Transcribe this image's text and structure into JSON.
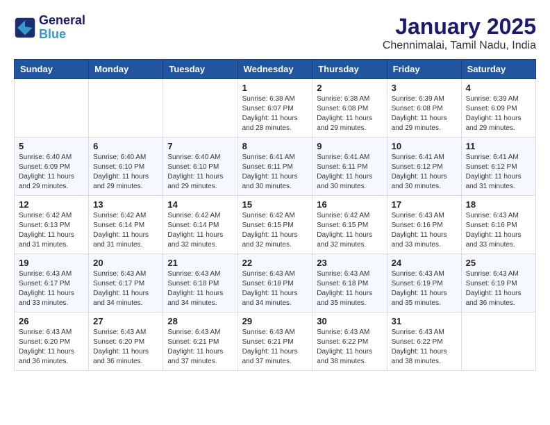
{
  "logo": {
    "line1": "General",
    "line2": "Blue"
  },
  "header": {
    "month": "January 2025",
    "location": "Chennimalai, Tamil Nadu, India"
  },
  "weekdays": [
    "Sunday",
    "Monday",
    "Tuesday",
    "Wednesday",
    "Thursday",
    "Friday",
    "Saturday"
  ],
  "weeks": [
    [
      {
        "day": "",
        "info": ""
      },
      {
        "day": "",
        "info": ""
      },
      {
        "day": "",
        "info": ""
      },
      {
        "day": "1",
        "info": "Sunrise: 6:38 AM\nSunset: 6:07 PM\nDaylight: 11 hours and 28 minutes."
      },
      {
        "day": "2",
        "info": "Sunrise: 6:38 AM\nSunset: 6:08 PM\nDaylight: 11 hours and 29 minutes."
      },
      {
        "day": "3",
        "info": "Sunrise: 6:39 AM\nSunset: 6:08 PM\nDaylight: 11 hours and 29 minutes."
      },
      {
        "day": "4",
        "info": "Sunrise: 6:39 AM\nSunset: 6:09 PM\nDaylight: 11 hours and 29 minutes."
      }
    ],
    [
      {
        "day": "5",
        "info": "Sunrise: 6:40 AM\nSunset: 6:09 PM\nDaylight: 11 hours and 29 minutes."
      },
      {
        "day": "6",
        "info": "Sunrise: 6:40 AM\nSunset: 6:10 PM\nDaylight: 11 hours and 29 minutes."
      },
      {
        "day": "7",
        "info": "Sunrise: 6:40 AM\nSunset: 6:10 PM\nDaylight: 11 hours and 29 minutes."
      },
      {
        "day": "8",
        "info": "Sunrise: 6:41 AM\nSunset: 6:11 PM\nDaylight: 11 hours and 30 minutes."
      },
      {
        "day": "9",
        "info": "Sunrise: 6:41 AM\nSunset: 6:11 PM\nDaylight: 11 hours and 30 minutes."
      },
      {
        "day": "10",
        "info": "Sunrise: 6:41 AM\nSunset: 6:12 PM\nDaylight: 11 hours and 30 minutes."
      },
      {
        "day": "11",
        "info": "Sunrise: 6:41 AM\nSunset: 6:12 PM\nDaylight: 11 hours and 31 minutes."
      }
    ],
    [
      {
        "day": "12",
        "info": "Sunrise: 6:42 AM\nSunset: 6:13 PM\nDaylight: 11 hours and 31 minutes."
      },
      {
        "day": "13",
        "info": "Sunrise: 6:42 AM\nSunset: 6:14 PM\nDaylight: 11 hours and 31 minutes."
      },
      {
        "day": "14",
        "info": "Sunrise: 6:42 AM\nSunset: 6:14 PM\nDaylight: 11 hours and 32 minutes."
      },
      {
        "day": "15",
        "info": "Sunrise: 6:42 AM\nSunset: 6:15 PM\nDaylight: 11 hours and 32 minutes."
      },
      {
        "day": "16",
        "info": "Sunrise: 6:42 AM\nSunset: 6:15 PM\nDaylight: 11 hours and 32 minutes."
      },
      {
        "day": "17",
        "info": "Sunrise: 6:43 AM\nSunset: 6:16 PM\nDaylight: 11 hours and 33 minutes."
      },
      {
        "day": "18",
        "info": "Sunrise: 6:43 AM\nSunset: 6:16 PM\nDaylight: 11 hours and 33 minutes."
      }
    ],
    [
      {
        "day": "19",
        "info": "Sunrise: 6:43 AM\nSunset: 6:17 PM\nDaylight: 11 hours and 33 minutes."
      },
      {
        "day": "20",
        "info": "Sunrise: 6:43 AM\nSunset: 6:17 PM\nDaylight: 11 hours and 34 minutes."
      },
      {
        "day": "21",
        "info": "Sunrise: 6:43 AM\nSunset: 6:18 PM\nDaylight: 11 hours and 34 minutes."
      },
      {
        "day": "22",
        "info": "Sunrise: 6:43 AM\nSunset: 6:18 PM\nDaylight: 11 hours and 34 minutes."
      },
      {
        "day": "23",
        "info": "Sunrise: 6:43 AM\nSunset: 6:18 PM\nDaylight: 11 hours and 35 minutes."
      },
      {
        "day": "24",
        "info": "Sunrise: 6:43 AM\nSunset: 6:19 PM\nDaylight: 11 hours and 35 minutes."
      },
      {
        "day": "25",
        "info": "Sunrise: 6:43 AM\nSunset: 6:19 PM\nDaylight: 11 hours and 36 minutes."
      }
    ],
    [
      {
        "day": "26",
        "info": "Sunrise: 6:43 AM\nSunset: 6:20 PM\nDaylight: 11 hours and 36 minutes."
      },
      {
        "day": "27",
        "info": "Sunrise: 6:43 AM\nSunset: 6:20 PM\nDaylight: 11 hours and 36 minutes."
      },
      {
        "day": "28",
        "info": "Sunrise: 6:43 AM\nSunset: 6:21 PM\nDaylight: 11 hours and 37 minutes."
      },
      {
        "day": "29",
        "info": "Sunrise: 6:43 AM\nSunset: 6:21 PM\nDaylight: 11 hours and 37 minutes."
      },
      {
        "day": "30",
        "info": "Sunrise: 6:43 AM\nSunset: 6:22 PM\nDaylight: 11 hours and 38 minutes."
      },
      {
        "day": "31",
        "info": "Sunrise: 6:43 AM\nSunset: 6:22 PM\nDaylight: 11 hours and 38 minutes."
      },
      {
        "day": "",
        "info": ""
      }
    ]
  ]
}
